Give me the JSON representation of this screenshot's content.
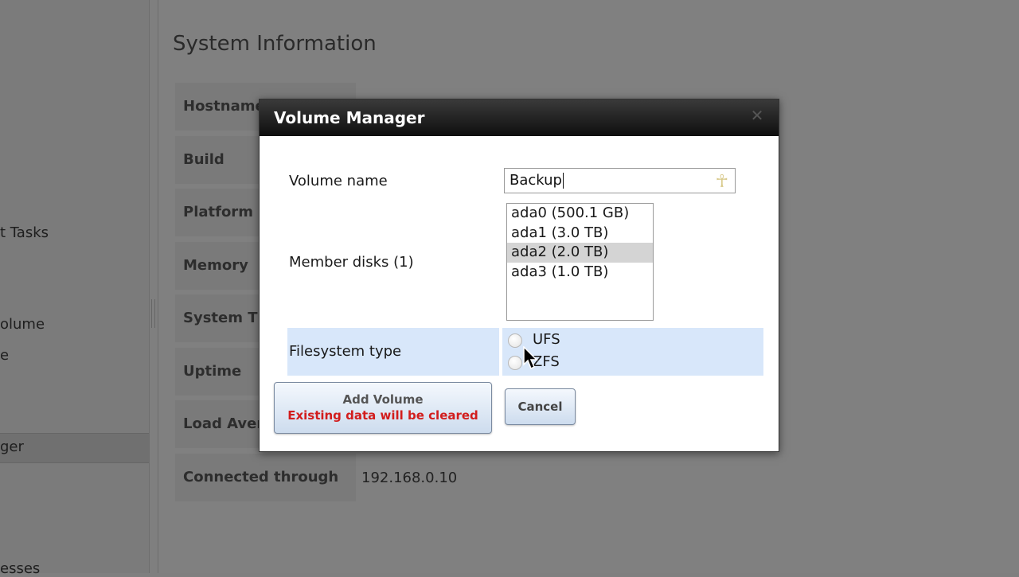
{
  "sidebar": {
    "items": [
      {
        "label": "t Tasks"
      },
      {
        "label": "olume"
      },
      {
        "label": "e"
      },
      {
        "label": "ger"
      },
      {
        "label": "esses"
      }
    ]
  },
  "main": {
    "title": "System Information",
    "info_rows": [
      {
        "label": "Hostname"
      },
      {
        "label": "Build"
      },
      {
        "label": "Platform"
      },
      {
        "label": "Memory"
      },
      {
        "label": "System Time"
      },
      {
        "label": "Uptime"
      },
      {
        "label": "Load Average"
      },
      {
        "label": "Connected through",
        "value": "192.168.0.10"
      }
    ]
  },
  "modal": {
    "title": "Volume Manager",
    "close_icon": "close-icon",
    "volume_name_label": "Volume name",
    "volume_name_value": "Backup",
    "member_disks_label": "Member disks (1)",
    "disks": [
      {
        "label": "ada0 (500.1 GB)",
        "selected": false
      },
      {
        "label": "ada1 (3.0 TB)",
        "selected": false
      },
      {
        "label": "ada2 (2.0 TB)",
        "selected": true
      },
      {
        "label": "ada3 (1.0 TB)",
        "selected": false
      }
    ],
    "filesystem_type_label": "Filesystem type",
    "fs_options": [
      {
        "label": "UFS",
        "checked": false
      },
      {
        "label": "ZFS",
        "checked": false
      }
    ],
    "add_button": {
      "line1": "Add Volume",
      "line2": "Existing data will be cleared"
    },
    "cancel_button": "Cancel"
  },
  "colors": {
    "overlay_gray": "#808080",
    "header_dark": "#1a1a1a",
    "fs_row_bg": "#d8e7fa",
    "warning_red": "#d21d1d"
  }
}
